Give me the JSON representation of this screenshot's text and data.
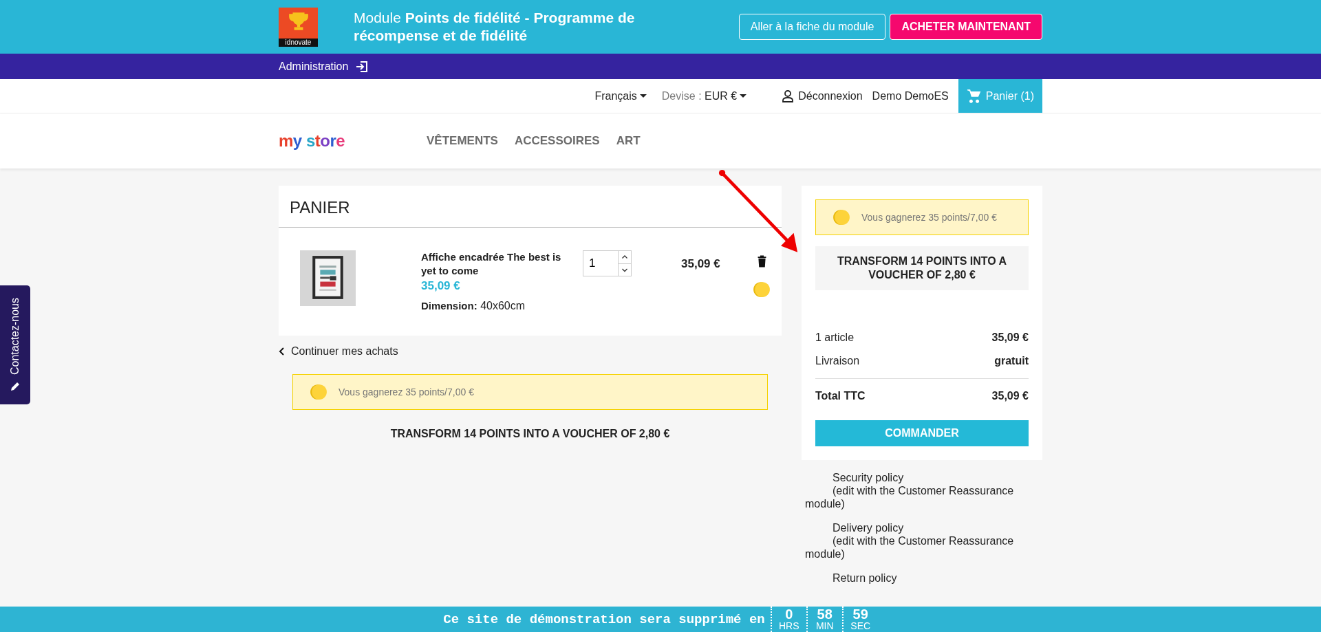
{
  "promo_bar": {
    "logo_caption": "idnovate",
    "title": "Module **Points de fidélité - Programme de récompense et de fidélité**",
    "buttons": [
      {
        "label": "Aller à la fiche du module",
        "kind": "outline"
      },
      {
        "label": "ACHETER MAINTENANT",
        "kind": "primary"
      }
    ]
  },
  "admin_bar": {
    "label": "Administration"
  },
  "header_nav": {
    "language": "Français",
    "currency_label": "Devise :",
    "currency": "EUR €",
    "logout": "Déconnexion",
    "user": "Demo DemoES",
    "cart": "Panier (1)"
  },
  "logo": {
    "text": "my store"
  },
  "menu": [
    "VÊTEMENTS",
    "ACCESSOIRES",
    "ART"
  ],
  "cart": {
    "title": "PANIER",
    "items": [
      {
        "name": "Affiche encadrée The best is yet to come",
        "unit_price": "35,09 €",
        "attribute_label": "Dimension:",
        "attribute_value": "40x60cm",
        "quantity": "1",
        "total": "35,09 €"
      }
    ],
    "continue": "Continuer mes achats",
    "loyalty_notice": "Vous gagnerez 35 points/7,00 €",
    "transform": "TRANSFORM 14 POINTS INTO A VOUCHER OF 2,80 €"
  },
  "summary": {
    "loyalty_notice": "Vous gagnerez 35 points/7,00 €",
    "transform": "TRANSFORM 14 POINTS INTO A VOUCHER OF 2,80 €",
    "lines": [
      {
        "label": "1 article",
        "value": "35,09 €"
      },
      {
        "label": "Livraison",
        "value": "gratuit"
      }
    ],
    "total": {
      "label": "Total TTC",
      "value": "35,09 €"
    },
    "button": "COMMANDER"
  },
  "reassurance": [
    {
      "title": "Security policy",
      "note": "(edit with the Customer Reassurance module)"
    },
    {
      "title": "Delivery policy",
      "note": "(edit with the Customer Reassurance module)"
    },
    {
      "title": "Return policy"
    }
  ],
  "contact_tab": "Contactez-nous",
  "countdown": {
    "message": "Ce site de démonstration sera supprimé en",
    "units": [
      {
        "value": "0",
        "label": "HRS"
      },
      {
        "value": "58",
        "label": "MIN"
      },
      {
        "value": "59",
        "label": "SEC"
      }
    ]
  }
}
